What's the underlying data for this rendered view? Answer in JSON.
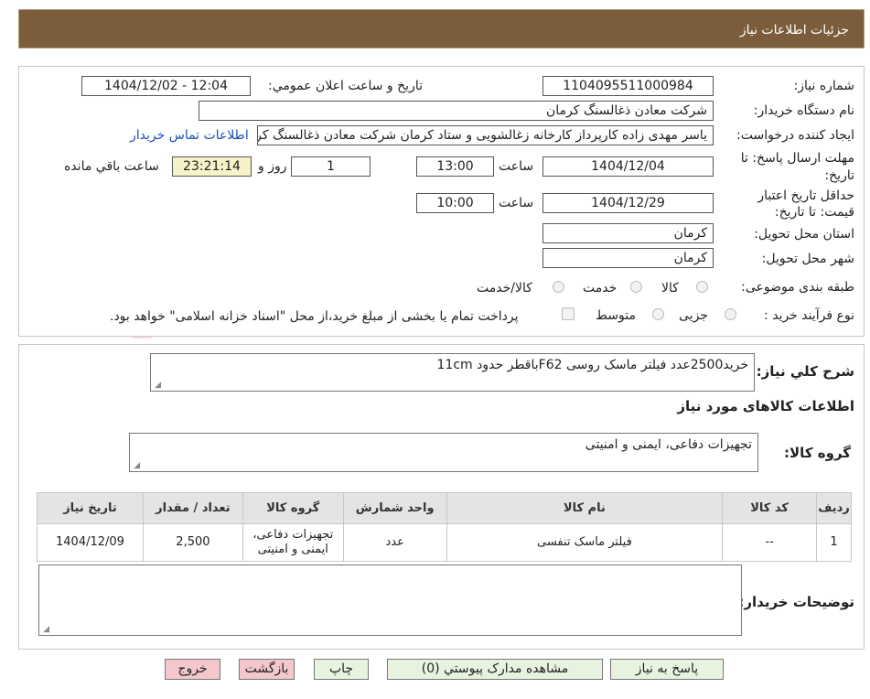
{
  "header": {
    "title": "جزئیات اطلاعات نیاز"
  },
  "form": {
    "need_number_label": "شماره نیاز:",
    "need_number": "1104095511000984",
    "announce_label": "تاریخ و ساعت اعلان عمومي:",
    "announce_value": "1404/12/02 - 12:04",
    "buyer_org_label": "نام دستگاه خریدار:",
    "buyer_org": "شرکت معادن ذغالسنگ کرمان",
    "requester_label": "ایجاد کننده درخواست:",
    "requester": "یاسر مهدی زاده کارپرداز کارخانه زغالشویی و ستاد کرمان شرکت معادن ذغالسنگ کرمان",
    "contact_link": "اطلاعات تماس خریدار",
    "reply_deadline_label_1": "مهلت ارسال پاسخ: تا",
    "reply_deadline_label_2": "تاریخ:",
    "reply_date": "1404/12/04",
    "time_label": "ساعت",
    "reply_time": "13:00",
    "days_value": "1",
    "days_label": "روز و",
    "remaining_time": "23:21:14",
    "remaining_label": "ساعت باقي مانده",
    "validity_label_1": "حداقل تاریخ اعتبار",
    "validity_label_2": "قیمت: تا تاریخ:",
    "validity_date": "1404/12/29",
    "validity_time_label": "ساعت",
    "validity_time": "10:00",
    "province_label": "استان محل تحویل:",
    "province": "کرمان",
    "city_label": "شهر محل تحویل:",
    "city": "کرمان",
    "category_label": "طبقه بندی موضوعی:",
    "category_options": [
      "کالا",
      "خدمت",
      "کالا/خدمت"
    ],
    "process_label": "نوع فرآیند خرید :",
    "process_options": [
      "جزیی",
      "متوسط"
    ],
    "payment_note": "پرداخت تمام یا بخشی از مبلغ خرید،از محل \"اسناد خزانه اسلامی\" خواهد بود."
  },
  "summary": {
    "label": "شرح کلي نیاز:",
    "text": "خرید2500عدد فیلتر ماسک روسی F62باقطر حدود 11cm",
    "goods_title": "اطلاعات کالاهای مورد نیاز",
    "group_label": "گروه کالا:",
    "group_value": "تجهیزات دفاعی، ایمنی و امنیتی"
  },
  "table": {
    "headers": [
      "ردیف",
      "کد کالا",
      "نام کالا",
      "واحد شمارش",
      "گروه کالا",
      "تعداد / مقدار",
      "تاریخ نیاز"
    ],
    "rows": [
      [
        "1",
        "--",
        "فیلتر ماسک تنفسی",
        "عدد",
        "تجهیزات دفاعی، ایمنی و امنیتی",
        "2,500",
        "1404/12/09"
      ]
    ]
  },
  "notes": {
    "label": "توضیحات خریدار:",
    "value": ""
  },
  "buttons": {
    "reply": "پاسخ به نیاز",
    "attachments": "مشاهده مدارک پیوستي (0)",
    "print": "چاپ",
    "back": "بازگشت",
    "exit": "خروج"
  },
  "watermark": "AriaTender.neT",
  "colors": {
    "header_bg": "#7b5c3b",
    "button_green": "#e7f3df",
    "button_red": "#f3c7cc",
    "link": "#1a4fb8"
  }
}
